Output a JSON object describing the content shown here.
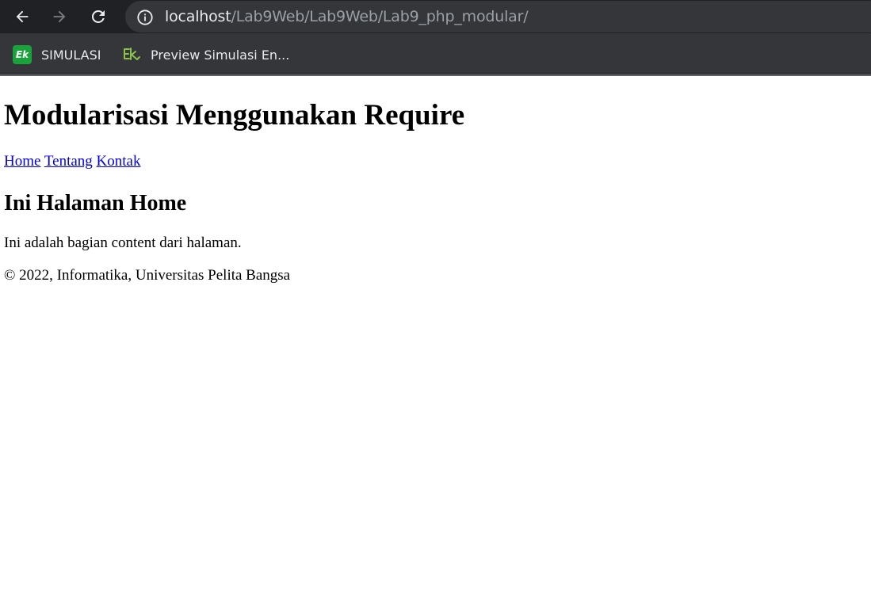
{
  "browser": {
    "url_host": "localhost",
    "url_path": "/Lab9Web/Lab9Web/Lab9_php_modular/",
    "bookmarks": [
      {
        "label": "SIMULASI",
        "icon": "ek-green-icon"
      },
      {
        "label": "Preview Simulasi En...",
        "icon": "ek-outline-icon"
      }
    ]
  },
  "page": {
    "title": "Modularisasi Menggunakan Require",
    "nav": {
      "home": "Home",
      "tentang": "Tentang",
      "kontak": "Kontak"
    },
    "heading": "Ini Halaman Home",
    "content": "Ini adalah bagian content dari halaman.",
    "footer": "© 2022, Informatika, Universitas Pelita Bangsa"
  },
  "colors": {
    "chrome_bg": "#202124",
    "toolbar_bg": "#35363a",
    "link": "#0000ee",
    "bookmark_green": "#1aa33a"
  }
}
